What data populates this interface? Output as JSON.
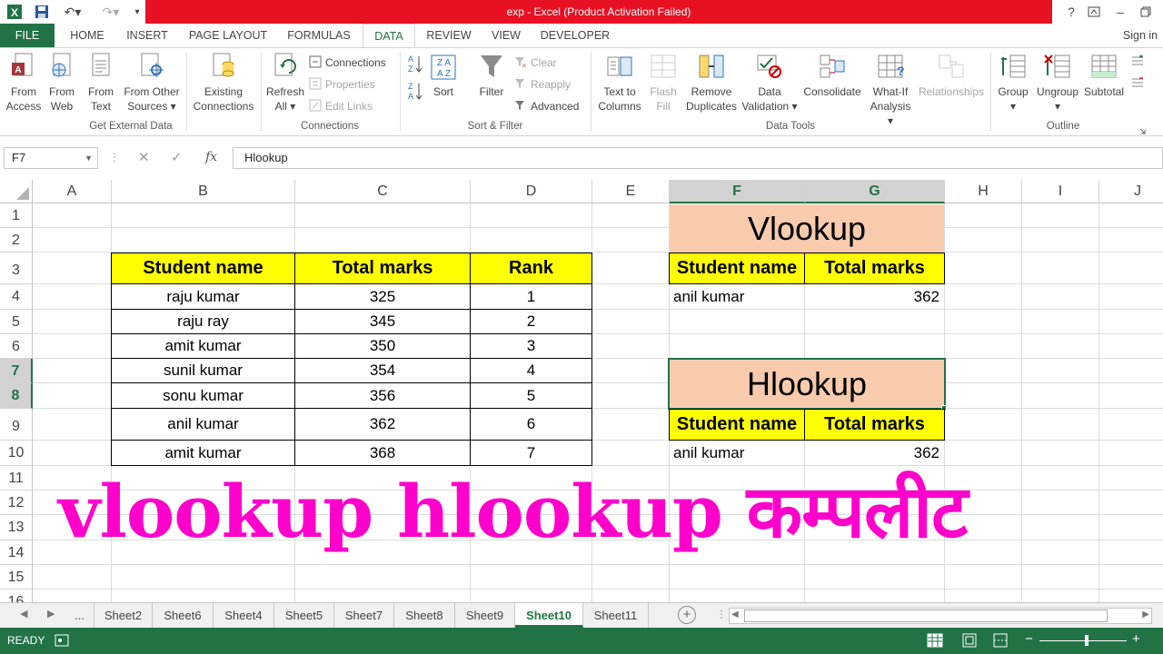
{
  "window": {
    "title": "exp -  Excel (Product Activation Failed)",
    "help": "?",
    "signin": "Sign in"
  },
  "tabs": [
    "FILE",
    "HOME",
    "INSERT",
    "PAGE LAYOUT",
    "FORMULAS",
    "DATA",
    "REVIEW",
    "VIEW",
    "DEVELOPER"
  ],
  "ribbon": {
    "get_external": {
      "label": "Get External Data",
      "from_access": [
        "From",
        "Access"
      ],
      "from_web": [
        "From",
        "Web"
      ],
      "from_text": [
        "From",
        "Text"
      ],
      "from_other": [
        "From Other",
        "Sources ▾"
      ],
      "existing": [
        "Existing",
        "Connections"
      ]
    },
    "connections": {
      "label": "Connections",
      "refresh": [
        "Refresh",
        "All ▾"
      ],
      "connections": "Connections",
      "properties": "Properties",
      "edit_links": "Edit Links"
    },
    "sort_filter": {
      "label": "Sort & Filter",
      "sort": "Sort",
      "filter": "Filter",
      "clear": "Clear",
      "reapply": "Reapply",
      "advanced": "Advanced"
    },
    "data_tools": {
      "label": "Data Tools",
      "text_to_columns": [
        "Text to",
        "Columns"
      ],
      "flash_fill": [
        "Flash",
        "Fill"
      ],
      "remove_duplicates": [
        "Remove",
        "Duplicates"
      ],
      "data_validation": [
        "Data",
        "Validation ▾"
      ],
      "consolidate": "Consolidate",
      "what_if": [
        "What-If",
        "Analysis ▾"
      ],
      "relationships": "Relationships"
    },
    "outline": {
      "label": "Outline",
      "group": [
        "Group",
        "▾"
      ],
      "ungroup": [
        "Ungroup",
        "▾"
      ],
      "subtotal": "Subtotal"
    }
  },
  "formula_bar": {
    "name_box": "F7",
    "fx": "fx",
    "formula": "Hlookup"
  },
  "columns": [
    "A",
    "B",
    "C",
    "D",
    "E",
    "F",
    "G",
    "H",
    "I",
    "J"
  ],
  "rows": [
    "1",
    "2",
    "3",
    "4",
    "5",
    "6",
    "7",
    "8",
    "9",
    "10",
    "11",
    "12",
    "13",
    "14",
    "15",
    "16"
  ],
  "main_table": {
    "headers": [
      "Student name",
      "Total marks",
      "Rank"
    ],
    "rows": [
      [
        "raju  kumar",
        "325",
        "1"
      ],
      [
        "raju ray",
        "345",
        "2"
      ],
      [
        "amit kumar",
        "350",
        "3"
      ],
      [
        "sunil kumar",
        "354",
        "4"
      ],
      [
        "sonu kumar",
        "356",
        "5"
      ],
      [
        "anil kumar",
        "362",
        "6"
      ],
      [
        "amit kumar",
        "368",
        "7"
      ]
    ]
  },
  "vlookup_box": {
    "title": "Vlookup",
    "headers": [
      "Student name",
      "Total marks"
    ],
    "name": "anil kumar",
    "marks": "362"
  },
  "hlookup_box": {
    "title": "Hlookup",
    "headers": [
      "Student name",
      "Total marks"
    ],
    "name": "anil kumar",
    "marks": "362"
  },
  "overlay_text": "vlookup hlookup कम्पलीट",
  "sheets": [
    "...",
    "Sheet2",
    "Sheet6",
    "Sheet4",
    "Sheet5",
    "Sheet7",
    "Sheet8",
    "Sheet9",
    "Sheet10",
    "Sheet11"
  ],
  "active_sheet": "Sheet10",
  "status": {
    "ready": "READY",
    "zoom_minus": "−",
    "zoom_plus": "+"
  },
  "colors": {
    "excel_green": "#217346",
    "title_red": "#e81123",
    "header_yellow": "#ffff00",
    "lookup_peach": "#f8cbad",
    "overlay_magenta": "#ff00cc"
  }
}
